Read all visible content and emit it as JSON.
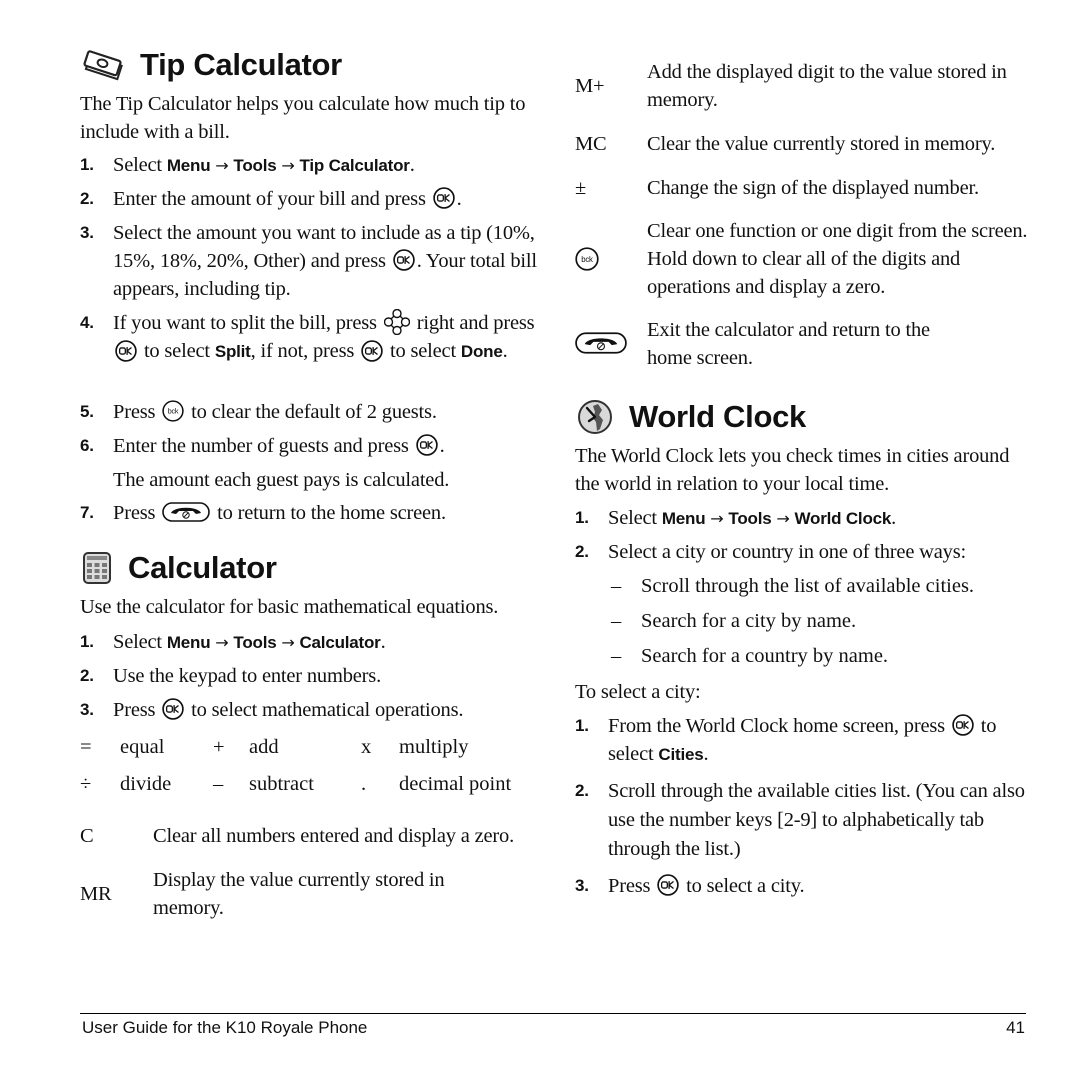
{
  "tip_calculator": {
    "title": "Tip Calculator",
    "icon": "money-bill-icon",
    "intro": "The Tip Calculator helps you calculate how much tip to include with a bill.",
    "steps": [
      {
        "num": "1.",
        "pre": "Select ",
        "menu": "Menu",
        "arrow1": " → ",
        "tools": "Tools",
        "arrow2": " → ",
        "item": "Tip Calculator",
        "post": "."
      },
      {
        "num": "2.",
        "pre": "Enter the amount of your bill and press",
        "post": "."
      },
      {
        "num": "3.",
        "pre": "Select the amount you want to include as a tip (10%, 15%, 18%, 20%, Other) and press",
        "post": ". Your total bill appears, including tip."
      },
      {
        "num": "4.",
        "pre": "If you want to split the bill, press",
        "mid1": "right and press",
        "mid2": "to select",
        "split": "Split",
        "mid3": ", if not, press",
        "mid4": "to select",
        "done": "Done",
        "post": "."
      },
      {
        "num": "5.",
        "pre": "Press",
        "post": "to clear the default of 2 guests."
      },
      {
        "num": "6.",
        "pre": "Enter the number of guests and press",
        "post": ".",
        "extra": "The amount each guest pays is calculated."
      },
      {
        "num": "7.",
        "pre": "Press",
        "post": "to return to the home screen."
      }
    ]
  },
  "calculator": {
    "title": "Calculator",
    "icon": "calculator-icon",
    "intro": "Use the calculator for basic mathematical equations.",
    "steps": [
      {
        "num": "1.",
        "pre": "Select ",
        "menu": "Menu",
        "arrow1": " → ",
        "tools": "Tools",
        "arrow2": " → ",
        "item": "Calculator",
        "post": "."
      },
      {
        "num": "2.",
        "pre": "Use the keypad to enter numbers."
      },
      {
        "num": "3.",
        "pre": "Press",
        "post": "to select mathematical operations."
      }
    ],
    "operations": [
      {
        "symbol": "=",
        "label": "equal"
      },
      {
        "symbol": "+",
        "label": "add"
      },
      {
        "symbol": "x",
        "label": "multiply"
      },
      {
        "symbol": "÷",
        "label": "divide"
      },
      {
        "symbol": "–",
        "label": "subtract"
      },
      {
        "symbol": ".",
        "label": "decimal point"
      }
    ],
    "functions": [
      {
        "term": "C",
        "desc": "Clear all numbers entered and display a zero."
      },
      {
        "term": "MR",
        "desc": "Display the value currently stored in memory."
      },
      {
        "term": "M+",
        "desc": "Add the displayed digit to the value stored in memory."
      },
      {
        "term": "MC",
        "desc": "Clear the value currently stored in memory."
      },
      {
        "term": "±",
        "desc": "Change the sign of the displayed number."
      },
      {
        "term_icon": "back-key-icon",
        "desc": "Clear one function or one digit from the screen. Hold down to clear all of the digits and operations and display a zero."
      },
      {
        "term_icon": "end-key-icon",
        "desc": "Exit the calculator and return to the home screen."
      }
    ]
  },
  "world_clock": {
    "title": "World Clock",
    "icon": "world-clock-icon",
    "intro": "The World Clock lets you check times in cities around the world in relation to your local time.",
    "steps": [
      {
        "num": "1.",
        "pre": "Select ",
        "menu": "Menu",
        "arrow1": " → ",
        "tools": "Tools",
        "arrow2": " → ",
        "item": "World Clock",
        "post": "."
      },
      {
        "num": "2.",
        "pre": "Select a city or country in one of three ways:"
      }
    ],
    "ways": [
      "Scroll through the list of available cities.",
      "Search for a city by name.",
      "Search for a country by name."
    ],
    "select_city_label": "To select a city:",
    "city_steps": [
      {
        "num": "1.",
        "pre": "From the World Clock home screen, press",
        "mid": "to select ",
        "cities": "Cities",
        "post": "."
      },
      {
        "num": "2.",
        "pre": "Scroll through the available cities list. (You can also use the number keys [2-9] to alphabetically tab through the list.)"
      },
      {
        "num": "3.",
        "pre": "Press",
        "post": "to select a city."
      }
    ]
  },
  "footer": {
    "guide_title": "User Guide for the K10 Royale Phone",
    "page_number": "41"
  }
}
